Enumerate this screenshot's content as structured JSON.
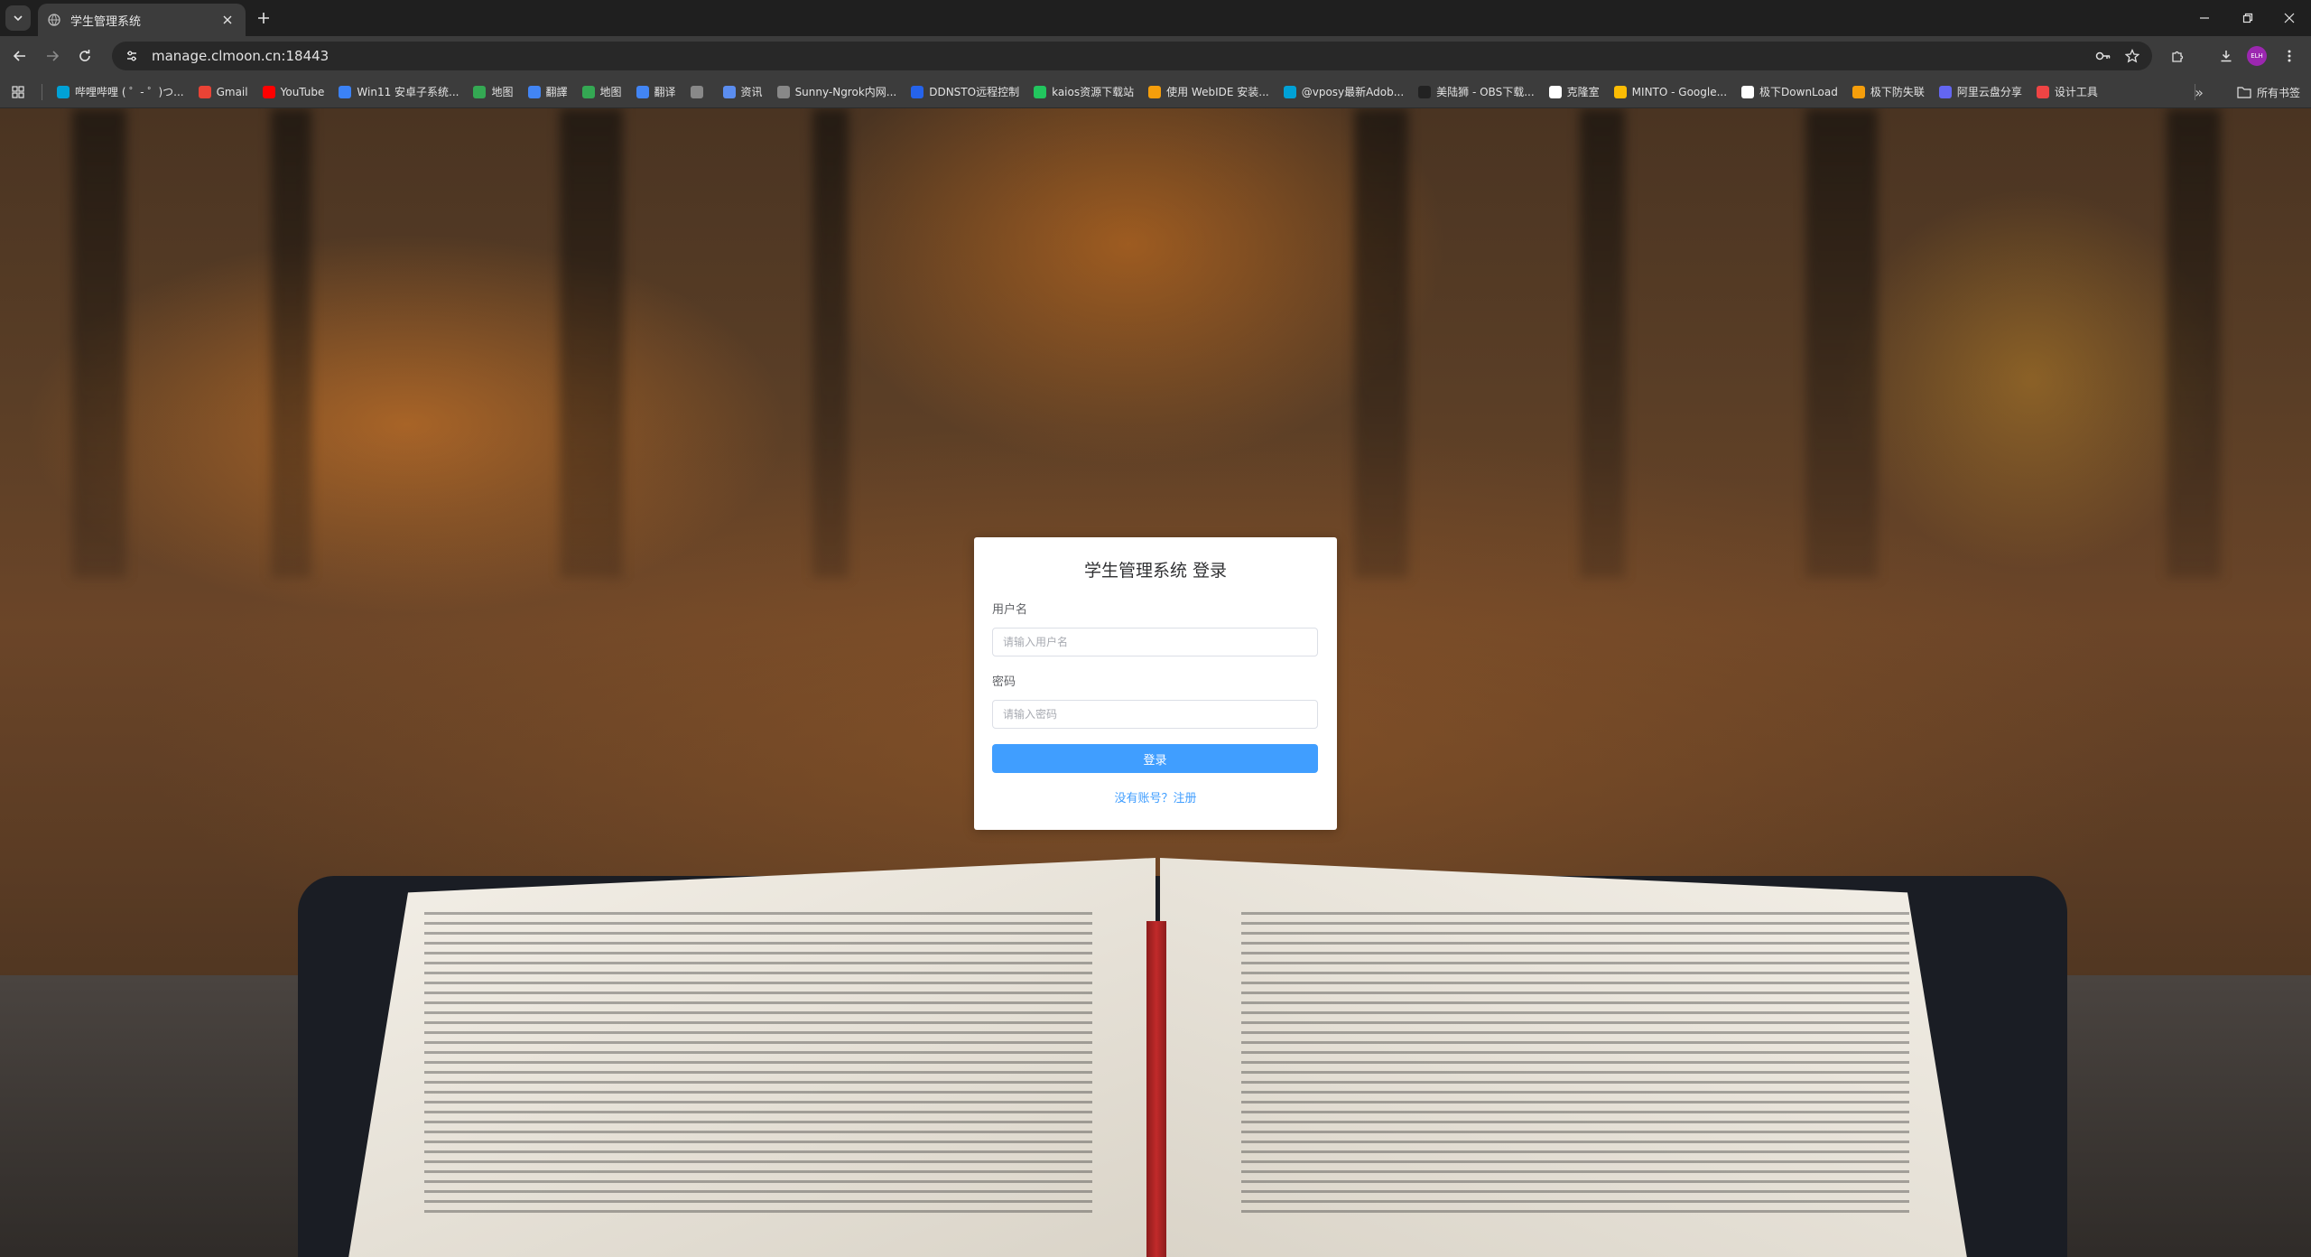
{
  "browser": {
    "tab_title": "学生管理系统",
    "url": "manage.clmoon.cn:18443",
    "avatar_text": "ELH"
  },
  "bookmarks": {
    "items": [
      {
        "label": "哔哩哔哩 ( ゜- ゜)つ...",
        "icon": "bilibili-icon",
        "color": "#00a1d6"
      },
      {
        "label": "Gmail",
        "icon": "gmail-icon",
        "color": "#ea4335"
      },
      {
        "label": "YouTube",
        "icon": "youtube-icon",
        "color": "#ff0000"
      },
      {
        "label": "Win11 安卓子系统...",
        "icon": "win11-icon",
        "color": "#3b82f6"
      },
      {
        "label": "地图",
        "icon": "maps-icon",
        "color": "#34a853"
      },
      {
        "label": "翻譯",
        "icon": "translate-icon",
        "color": "#4285f4"
      },
      {
        "label": "地图",
        "icon": "maps-icon",
        "color": "#34a853"
      },
      {
        "label": "翻译",
        "icon": "translate-icon",
        "color": "#4285f4"
      },
      {
        "label": "",
        "icon": "globe-icon",
        "color": "#888888"
      },
      {
        "label": "资讯",
        "icon": "news-icon",
        "color": "#5b8def"
      },
      {
        "label": "Sunny-Ngrok内网...",
        "icon": "globe-icon",
        "color": "#888888"
      },
      {
        "label": "DDNSTO远程控制",
        "icon": "ddnsto-icon",
        "color": "#2563eb"
      },
      {
        "label": "kaios资源下载站",
        "icon": "kaios-icon",
        "color": "#22c55e"
      },
      {
        "label": "使用 WebIDE 安装...",
        "icon": "webide-icon",
        "color": "#f59e0b"
      },
      {
        "label": "@vposy最新Adob...",
        "icon": "bilibili-icon",
        "color": "#00a1d6"
      },
      {
        "label": "美陆狮 - OBS下载...",
        "icon": "m-icon",
        "color": "#222222"
      },
      {
        "label": "克隆室",
        "icon": "github-icon",
        "color": "#ffffff"
      },
      {
        "label": "MINTO - Google...",
        "icon": "drive-icon",
        "color": "#fbbc04"
      },
      {
        "label": "极下DownLoad",
        "icon": "download-site-icon",
        "color": "#ffffff"
      },
      {
        "label": "极下防失联",
        "icon": "bolt-icon",
        "color": "#f59e0b"
      },
      {
        "label": "阿里云盘分享",
        "icon": "aliyun-icon",
        "color": "#6366f1"
      },
      {
        "label": "设计工具",
        "icon": "design-icon",
        "color": "#ef4444"
      }
    ],
    "all_bookmarks_label": "所有书签"
  },
  "login": {
    "title": "学生管理系统 登录",
    "username_label": "用户名",
    "username_placeholder": "请输入用户名",
    "password_label": "密码",
    "password_placeholder": "请输入密码",
    "submit_label": "登录",
    "register_link": "没有账号？注册"
  },
  "colors": {
    "accent": "#409eff",
    "chrome_bg": "#1f1f1f",
    "toolbar_bg": "#3c3c3c"
  }
}
